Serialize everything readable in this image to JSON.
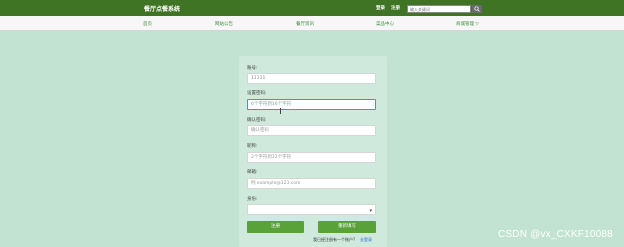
{
  "header": {
    "logo": "餐厅点餐系统",
    "login": "登录",
    "register": "注册",
    "search_placeholder": "输入关键词"
  },
  "nav": {
    "items": [
      "首页",
      "网站公告",
      "餐厅资讯",
      "菜品中心",
      "商城管理 ▽"
    ]
  },
  "form": {
    "account_label": "账号:",
    "account_value": "11111",
    "password_label": "设置密码:",
    "password_placeholder": "6个字符到16个字符",
    "confirm_label": "确认密码:",
    "confirm_placeholder": "确认密码",
    "nickname_label": "昵称:",
    "nickname_placeholder": "2个字符到12个字符",
    "email_label": "邮箱:",
    "email_placeholder": "例 example@123.com",
    "identity_label": "身份:",
    "identity_value": "",
    "register_button": "注册",
    "reset_button": "重新填写",
    "hint_text": "我已经注册有一个账户?",
    "hint_link": "去登录"
  },
  "watermark": "CSDN @vx_CXKF10088",
  "colors": {
    "topbar": "#3f7424",
    "background": "#c2e3d2",
    "button": "#59a23a",
    "nav_text": "#3c8a3c"
  }
}
